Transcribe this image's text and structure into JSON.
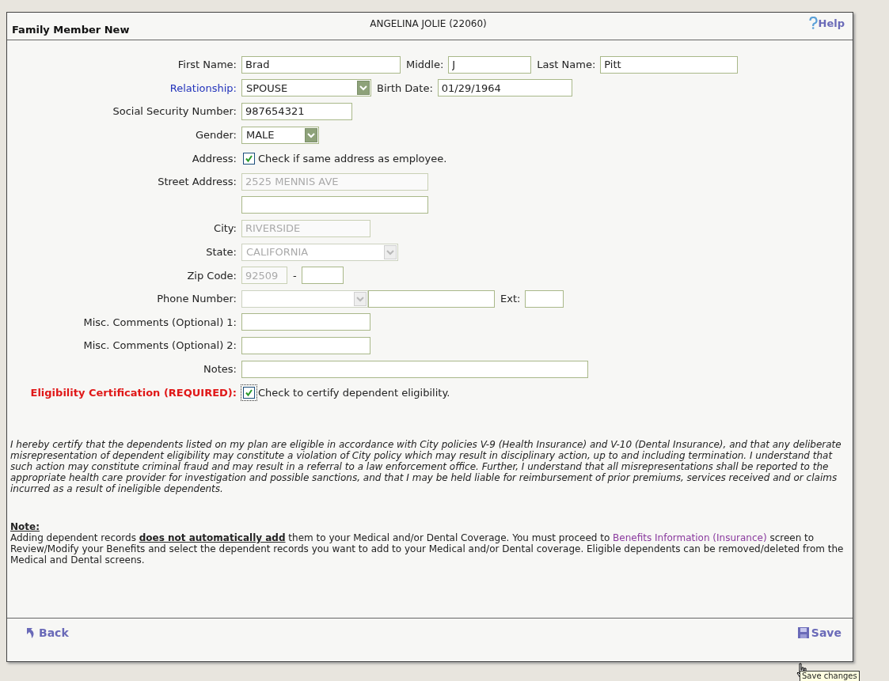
{
  "header": {
    "title": "Family Member New",
    "employee": "ANGELINA JOLIE (22060)",
    "help": "Help"
  },
  "form": [
    {
      "label": "First Name:",
      "kind": "plain",
      "controls": [
        {
          "kind": "text",
          "value": "Brad",
          "disabled": false
        },
        {
          "kind": "label",
          "text": "Middle:"
        },
        {
          "kind": "text",
          "value": "J",
          "disabled": false
        },
        {
          "kind": "label",
          "text": "Last Name:"
        },
        {
          "kind": "text",
          "value": "Pitt",
          "disabled": false
        }
      ]
    },
    {
      "label": "Relationship:",
      "kind": "link",
      "controls": [
        {
          "kind": "select",
          "value": "SPOUSE",
          "disabled": false
        },
        {
          "kind": "label",
          "text": "Birth Date:"
        },
        {
          "kind": "text",
          "value": "01/29/1964",
          "disabled": false
        }
      ]
    },
    {
      "label": "Social Security Number:",
      "kind": "plain",
      "controls": [
        {
          "kind": "text",
          "value": "987654321",
          "disabled": false
        }
      ]
    },
    {
      "label": "Gender:",
      "kind": "plain",
      "controls": [
        {
          "kind": "select",
          "value": "MALE",
          "disabled": false
        }
      ]
    },
    {
      "label": "Address:",
      "kind": "plain",
      "controls": [
        {
          "kind": "checkbox",
          "text": "Check if same address as employee.",
          "checked": true,
          "focused": false
        }
      ]
    },
    {
      "label": "Street Address:",
      "kind": "plain",
      "controls": [
        {
          "kind": "text",
          "value": "2525 MENNIS AVE",
          "disabled": true
        }
      ]
    },
    {
      "controls": [
        {
          "kind": "text",
          "disabled": false
        }
      ]
    },
    {
      "label": "City:",
      "kind": "plain",
      "controls": [
        {
          "kind": "text",
          "value": "RIVERSIDE",
          "disabled": true
        }
      ]
    },
    {
      "label": "State:",
      "kind": "plain",
      "controls": [
        {
          "kind": "select",
          "value": "CALIFORNIA",
          "disabled": true
        }
      ]
    },
    {
      "label": "Zip Code:",
      "kind": "plain",
      "controls": [
        {
          "kind": "text",
          "value": "92509",
          "disabled": true
        },
        {
          "kind": "label",
          "text": "-"
        },
        {
          "kind": "text",
          "disabled": false
        }
      ]
    },
    {
      "label": "Phone Number:",
      "kind": "plain",
      "controls": [
        {
          "kind": "select",
          "disabled": true
        },
        {
          "kind": "text",
          "disabled": false
        },
        {
          "kind": "label",
          "text": "Ext:"
        },
        {
          "kind": "text",
          "disabled": false
        }
      ]
    },
    {
      "label": "Misc. Comments (Optional) 1:",
      "kind": "plain",
      "controls": [
        {
          "kind": "text",
          "disabled": false
        }
      ]
    },
    {
      "label": "Misc. Comments (Optional) 2:",
      "kind": "plain",
      "controls": [
        {
          "kind": "text",
          "disabled": false
        }
      ]
    },
    {
      "label": "Notes:",
      "kind": "plain",
      "controls": [
        {
          "kind": "text",
          "disabled": false
        }
      ]
    },
    {
      "label": "Eligibility Certification (REQUIRED):",
      "kind": "required",
      "controls": [
        {
          "kind": "checkbox",
          "text": "Check to certify dependent eligibility.",
          "checked": true,
          "focused": true
        }
      ]
    }
  ],
  "certification": "I hereby certify that the dependents listed on my plan are eligible in accordance with City policies V-9 (Health Insurance) and V-10 (Dental Insurance), and that any deliberate misrepresentation of dependent eligibility may constitute a violation of City policy which may result in disciplinary action, up to and including termination. I understand that such action may constitute criminal fraud and may result in a referral to a law enforcement office. Further, I understand that all misrepresentations shall be reported to the appropriate health care provider for investigation and possible sanctions, and that I may be held liable for reimbursement of prior premiums, services received and or claims incurred as a result of ineligible dependents.",
  "note": {
    "heading": "Note:",
    "before": "Adding dependent records **does not automatically add** them to your Medical and/or Dental Coverage. You must proceed to",
    "link": "Benefits Information (Insurance)",
    "after": "screen to Review/Modify your Benefits and select the dependent records you want to add to your Medical and/or Dental coverage. Eligible dependents can be removed/deleted from the Medical and Dental screens."
  },
  "footer": {
    "back": "Back",
    "save": "Save",
    "tooltip": "Save changes"
  }
}
